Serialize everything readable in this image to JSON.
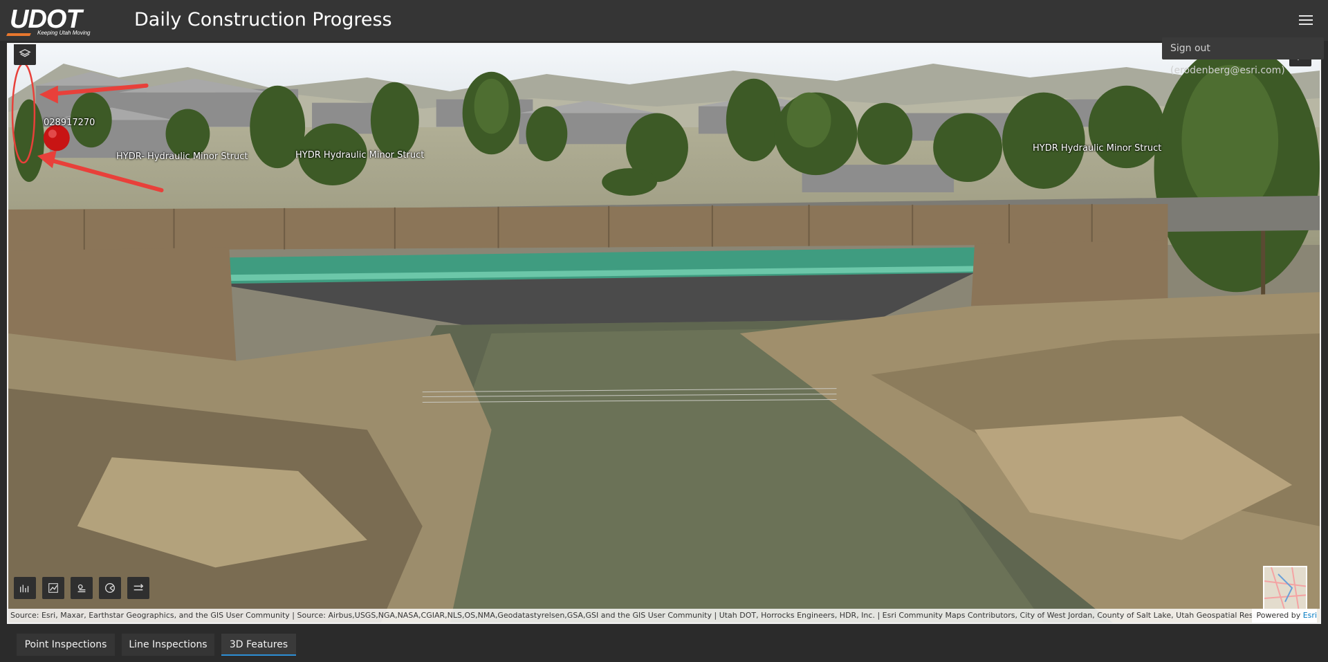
{
  "header": {
    "logo_text": "UDOT",
    "logo_tagline": "Keeping Utah Moving",
    "title": "Daily Construction Progress",
    "menu_icon": "hamburger-menu-icon"
  },
  "user_menu": {
    "signout_label": "Sign out (erodenberg@esri.com)"
  },
  "scene": {
    "labels": {
      "point_id": "028917270",
      "hydr_1": "HYDR- Hydraulic Minor Struct",
      "hydr_2": "HYDR  Hydraulic Minor Struct",
      "hydr_3": "HYDR  Hydraulic Minor Struct"
    },
    "widgets": {
      "layers": "layers-icon",
      "measure": "measure-icon",
      "tools": [
        "elevation-profile-icon",
        "line-of-sight-icon",
        "shadow-cast-icon",
        "viewshed-icon",
        "slice-icon"
      ]
    },
    "attribution": "Source: Esri, Maxar, Earthstar Geographics, and the GIS User Community | Source: Airbus,USGS,NGA,NASA,CGIAR,NLS,OS,NMA,Geodatastyrelsen,GSA,GSI and the GIS User Community | Utah DOT, Horrocks Engineers, HDR, Inc. | Esri Community Maps Contributors, City of West Jordan, County of Salt Lake, Utah Geospatial Resou...",
    "powered_prefix": "Powered by",
    "powered_brand": "Esri"
  },
  "tabs": [
    {
      "label": "Point Inspections",
      "active": false
    },
    {
      "label": "Line Inspections",
      "active": false
    },
    {
      "label": "3D Features",
      "active": true
    }
  ],
  "colors": {
    "header_bg": "#353535",
    "accent": "#2d8fd6",
    "annotation_red": "#e8403a",
    "logo_orange": "#e8772e"
  }
}
